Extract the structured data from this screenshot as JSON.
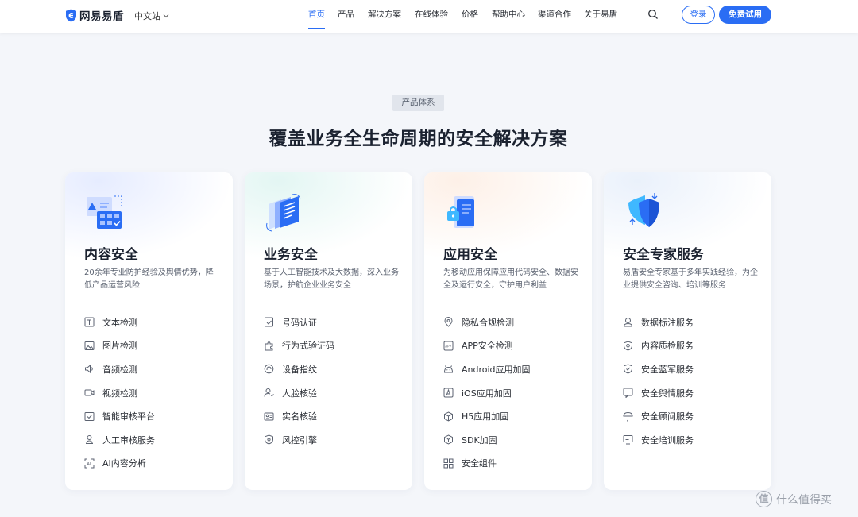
{
  "header": {
    "brand": "网易易盾",
    "site_switch": "中文站",
    "nav": [
      "首页",
      "产品",
      "解决方案",
      "在线体验",
      "价格",
      "帮助中心",
      "渠道合作",
      "关于易盾"
    ],
    "active_nav": "首页",
    "login": "登录",
    "trial": "免费试用"
  },
  "section": {
    "tag": "产品体系",
    "title": "覆盖业务全生命周期的安全解决方案"
  },
  "cards": [
    {
      "title": "内容安全",
      "desc": "20余年专业防护经验及舆情优势，降低产品运营风险",
      "items": [
        {
          "label": "文本检测",
          "icon": "text-icon"
        },
        {
          "label": "图片检测",
          "icon": "image-icon"
        },
        {
          "label": "音频检测",
          "icon": "audio-icon"
        },
        {
          "label": "视频检测",
          "icon": "video-icon"
        },
        {
          "label": "智能审核平台",
          "icon": "audit-platform-icon"
        },
        {
          "label": "人工审核服务",
          "icon": "manual-review-icon"
        },
        {
          "label": "AI内容分析",
          "icon": "ai-analysis-icon"
        }
      ]
    },
    {
      "title": "业务安全",
      "desc": "基于人工智能技术及大数据，深入业务场景，护航企业业务安全",
      "items": [
        {
          "label": "号码认证",
          "icon": "phone-verify-icon"
        },
        {
          "label": "行为式验证码",
          "icon": "puzzle-icon"
        },
        {
          "label": "设备指纹",
          "icon": "fingerprint-icon"
        },
        {
          "label": "人脸核验",
          "icon": "face-verify-icon"
        },
        {
          "label": "实名核验",
          "icon": "id-card-icon"
        },
        {
          "label": "风控引擎",
          "icon": "risk-engine-icon"
        }
      ]
    },
    {
      "title": "应用安全",
      "desc": "为移动应用保障应用代码安全、数据安全及运行安全，守护用户利益",
      "items": [
        {
          "label": "隐私合规检测",
          "icon": "privacy-icon"
        },
        {
          "label": "APP安全检测",
          "icon": "app-icon"
        },
        {
          "label": "Android应用加固",
          "icon": "android-icon"
        },
        {
          "label": "iOS应用加固",
          "icon": "ios-icon"
        },
        {
          "label": "H5应用加固",
          "icon": "h5-icon"
        },
        {
          "label": "SDK加固",
          "icon": "sdk-icon"
        },
        {
          "label": "安全组件",
          "icon": "components-icon"
        }
      ]
    },
    {
      "title": "安全专家服务",
      "desc": "易盾安全专家基于多年实践经验，为企业提供安全咨询、培训等服务",
      "items": [
        {
          "label": "数据标注服务",
          "icon": "data-label-icon"
        },
        {
          "label": "内容质检服务",
          "icon": "quality-check-icon"
        },
        {
          "label": "安全蓝军服务",
          "icon": "blue-team-icon"
        },
        {
          "label": "安全舆情服务",
          "icon": "opinion-icon"
        },
        {
          "label": "安全顾问服务",
          "icon": "consultant-icon"
        },
        {
          "label": "安全培训服务",
          "icon": "training-icon"
        }
      ]
    }
  ],
  "watermark": {
    "text": "什么值得买",
    "mark": "值"
  },
  "colors": {
    "accent": "#2a6df4",
    "background": "#f4f6fa",
    "title": "#1b2230"
  }
}
